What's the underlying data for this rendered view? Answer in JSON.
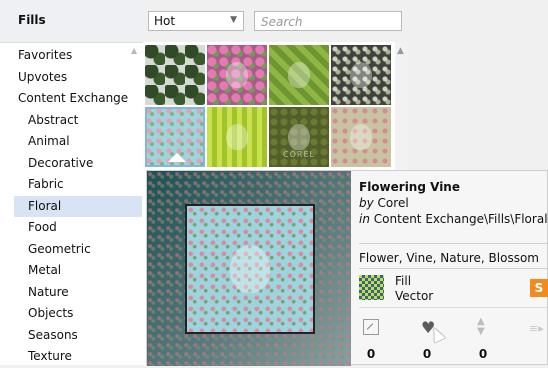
{
  "left": {
    "title": "Fills",
    "items": [
      {
        "label": "Favorites",
        "child": false
      },
      {
        "label": "Upvotes",
        "child": false
      },
      {
        "label": "Content Exchange",
        "child": false
      },
      {
        "label": "Abstract",
        "child": true
      },
      {
        "label": "Animal",
        "child": true
      },
      {
        "label": "Decorative",
        "child": true
      },
      {
        "label": "Fabric",
        "child": true
      },
      {
        "label": "Floral",
        "child": true,
        "selected": true
      },
      {
        "label": "Food",
        "child": true
      },
      {
        "label": "Geometric",
        "child": true
      },
      {
        "label": "Metal",
        "child": true
      },
      {
        "label": "Nature",
        "child": true
      },
      {
        "label": "Objects",
        "child": true
      },
      {
        "label": "Seasons",
        "child": true
      },
      {
        "label": "Texture",
        "child": true
      }
    ]
  },
  "toolbar": {
    "sort_value": "Hot",
    "search_placeholder": "Search"
  },
  "tiles_mark": "COREL",
  "preview": {
    "title": "Flowering Vine",
    "by_prefix": "by",
    "author": "Corel",
    "in_prefix": "in",
    "location": "Content Exchange\\Fills\\Floral",
    "tags": "Flower, Vine, Nature, Blossom",
    "fill_type": "Fill",
    "fill_kind": "Vector",
    "badge": "S",
    "counts": {
      "resize": "0",
      "favorite": "0",
      "vote": "0"
    }
  },
  "colors": {
    "accent_selected": "#d8e4f4",
    "badge_orange": "#f28a1e"
  }
}
